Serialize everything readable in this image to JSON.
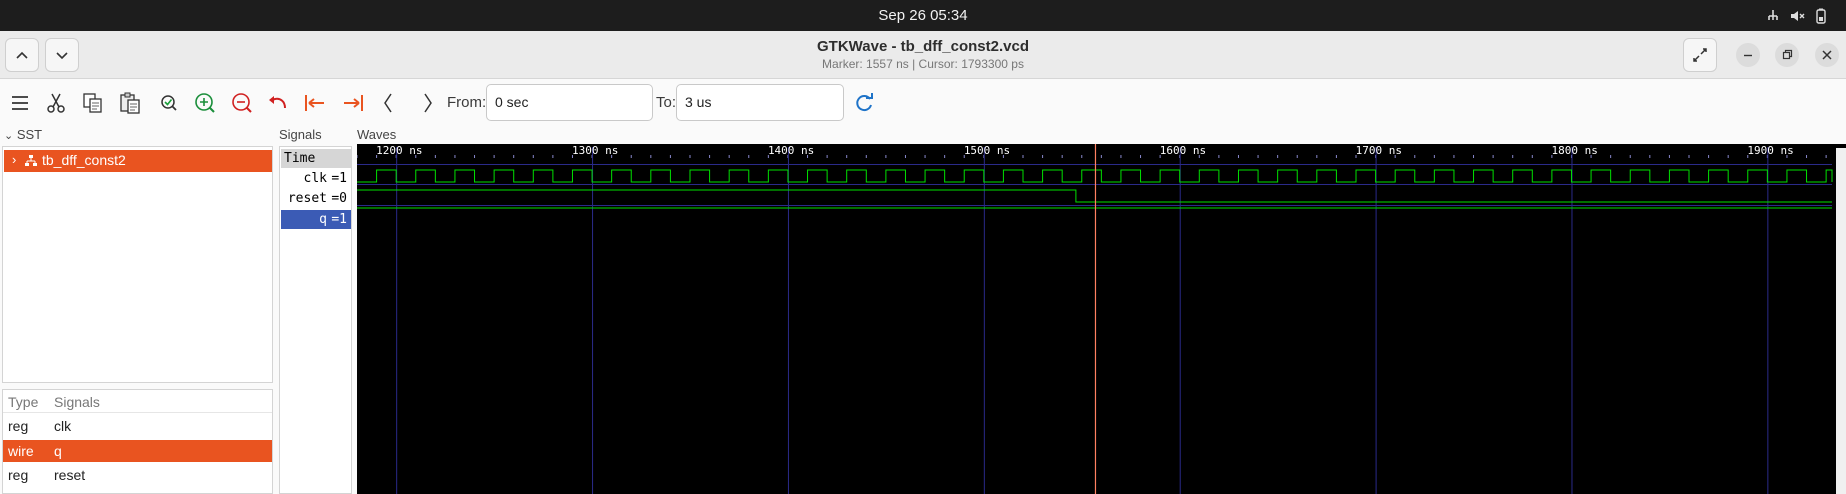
{
  "system_bar": {
    "clock": "Sep 26  05:34"
  },
  "window": {
    "title": "GTKWave - tb_dff_const2.vcd",
    "subtitle": "Marker: 1557 ns  |  Cursor: 1793300 ps"
  },
  "toolbar": {
    "from_label": "From:",
    "from_value": "0 sec",
    "to_label": "To:",
    "to_value": "3 us"
  },
  "sst": {
    "label": "SST",
    "tree": [
      {
        "label": "tb_dff_const2",
        "selected": true
      }
    ]
  },
  "signal_table": {
    "headers": {
      "type": "Type",
      "signals": "Signals"
    },
    "rows": [
      {
        "type": "reg",
        "name": "clk",
        "selected": false
      },
      {
        "type": "wire",
        "name": "q",
        "selected": true
      },
      {
        "type": "reg",
        "name": "reset",
        "selected": false
      }
    ]
  },
  "signals_pane": {
    "label": "Signals",
    "rows": [
      {
        "name": "Time",
        "value": "",
        "style": "header"
      },
      {
        "name": "clk",
        "value": "=1",
        "style": "normal"
      },
      {
        "name": "reset",
        "value": "=0",
        "style": "normal"
      },
      {
        "name": "q",
        "value": "=1",
        "style": "selected"
      }
    ]
  },
  "waves": {
    "label": "Waves",
    "time_labels": [
      "1200 ns",
      "1300 ns",
      "1400 ns",
      "1500 ns",
      "1600 ns",
      "1700 ns",
      "1800 ns",
      "1900 ns"
    ],
    "view_start_ns": 1180,
    "view_end_ns": 1933,
    "clock_period_ns": 20,
    "clock_first_rise_ns": 1190,
    "reset_fall_ns": 1547,
    "marker_ns": 1557,
    "colors": {
      "wave": "#00e000",
      "grid": "#2a2a8a",
      "marker": "#ff8060",
      "background": "#000000",
      "text": "#ffffff"
    }
  },
  "colors": {
    "accent": "#e95420",
    "selected_signal": "#3b5bb5"
  }
}
